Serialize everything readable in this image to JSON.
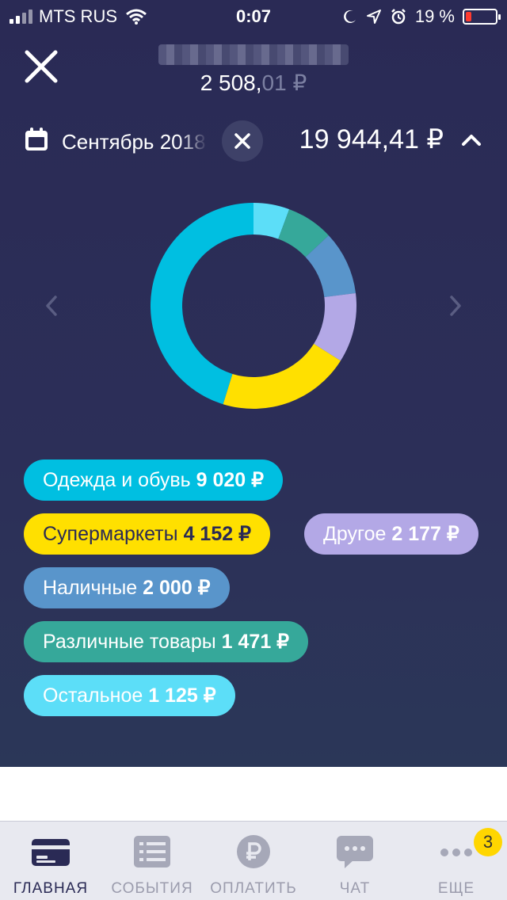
{
  "status_bar": {
    "carrier": "MTS RUS",
    "time": "0:07",
    "battery_text": "19 %",
    "battery_level": 0.19
  },
  "header": {
    "balance_main": "2 508,",
    "balance_cents": "01 ₽"
  },
  "period": {
    "month_label": "Сентябрь 2018",
    "total": "19 944,41 ₽"
  },
  "colors": {
    "background": "#2a2a55",
    "ring_empty": "#2a2a55",
    "badge": "#ffd600"
  },
  "chart_data": {
    "type": "pie",
    "categories": [
      "Одежда и обувь",
      "Супермаркеты",
      "Другое",
      "Наличные",
      "Различные товары",
      "Остальное"
    ],
    "values": [
      9020,
      4152,
      2177,
      2000,
      1471,
      1125
    ],
    "colors": [
      "#00bfe1",
      "#ffe000",
      "#b3a8e6",
      "#5995cb",
      "#36a89a",
      "#5cdef8"
    ]
  },
  "categories": [
    {
      "name": "Одежда и обувь",
      "amount": "9 020 ₽"
    },
    {
      "name": "Супермаркеты",
      "amount": "4 152 ₽"
    },
    {
      "name": "Другое",
      "amount": "2 177 ₽"
    },
    {
      "name": "Наличные",
      "amount": "2 000 ₽"
    },
    {
      "name": "Различные товары",
      "amount": "1 471 ₽"
    },
    {
      "name": "Остальное",
      "amount": "1 125 ₽"
    }
  ],
  "tab_bar": {
    "tabs": [
      {
        "label": "ГЛАВНАЯ",
        "icon": "card-icon"
      },
      {
        "label": "СОБЫТИЯ",
        "icon": "list-icon"
      },
      {
        "label": "ОПЛАТИТЬ",
        "icon": "ruble-icon"
      },
      {
        "label": "ЧАТ",
        "icon": "chat-icon"
      },
      {
        "label": "ЕЩЕ",
        "icon": "more-icon"
      }
    ],
    "more_badge": "3"
  }
}
